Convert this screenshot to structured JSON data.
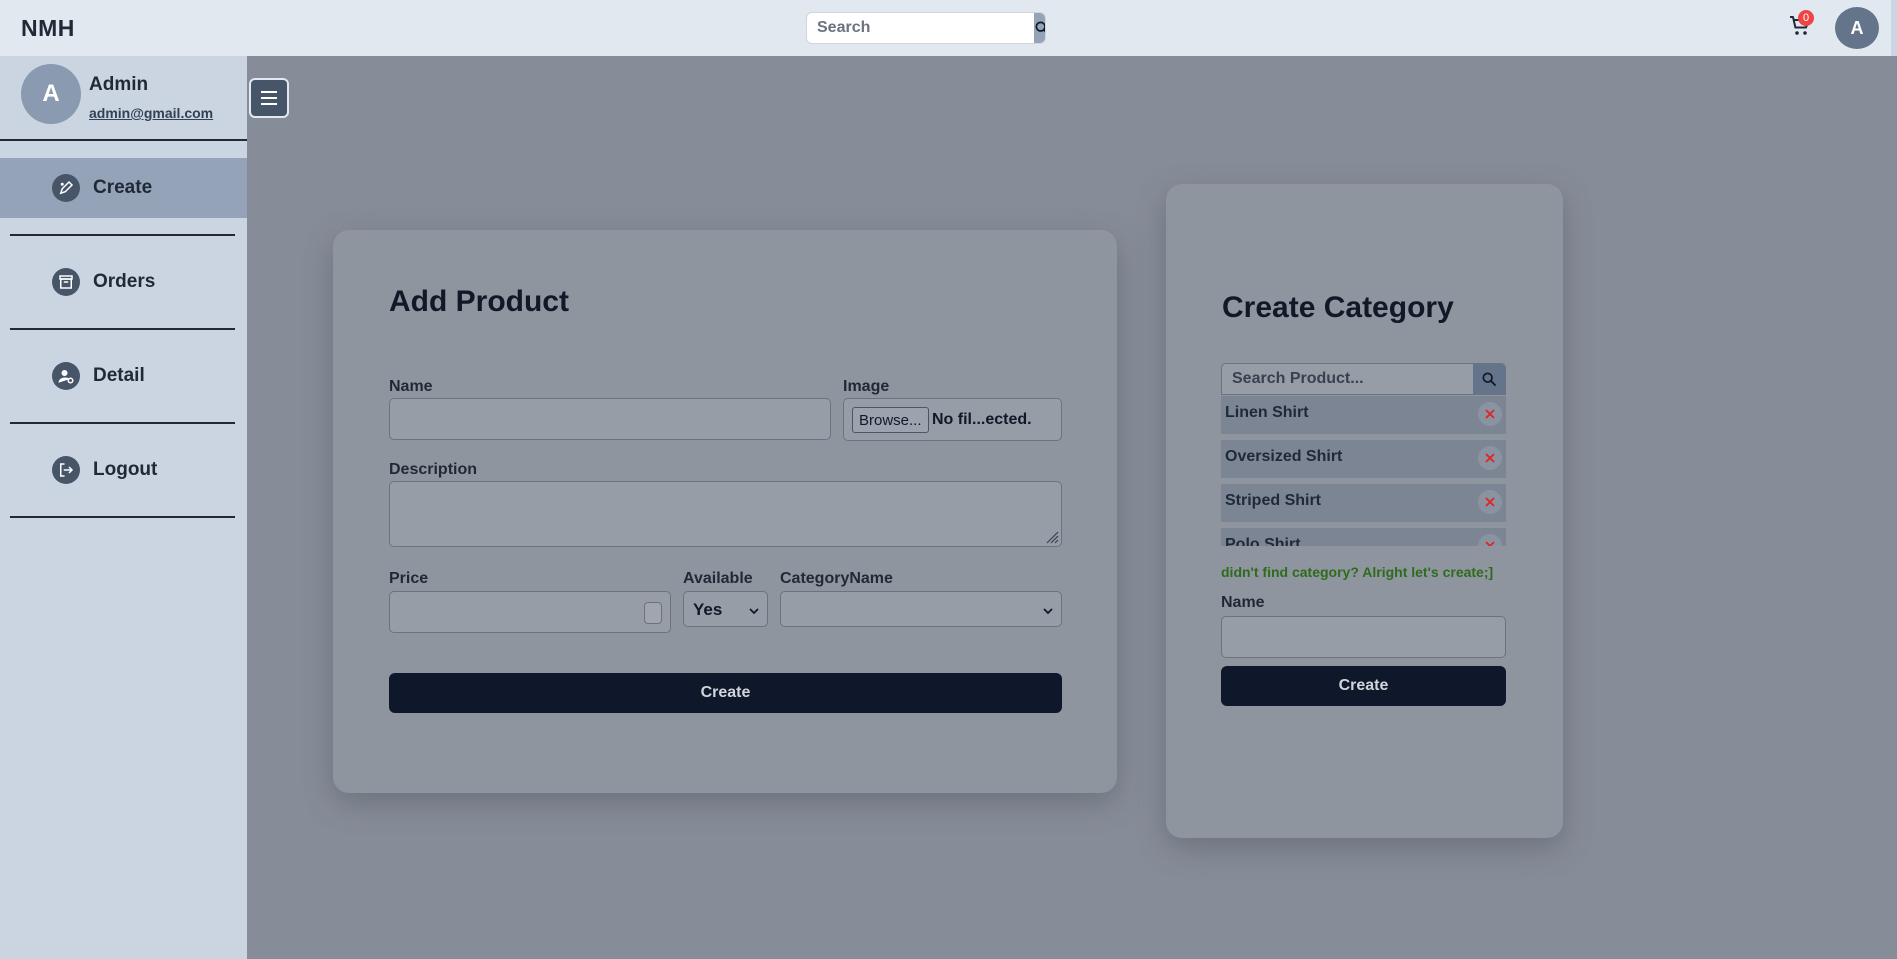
{
  "topbar": {
    "brand": "NMH",
    "search_placeholder": "Search",
    "cart_count": "0",
    "avatar_initial": "A"
  },
  "sidebar": {
    "profile": {
      "initial": "A",
      "name": "Admin",
      "email": "admin@gmail.com"
    },
    "items": [
      {
        "label": "Create",
        "icon": "create-icon",
        "active": true
      },
      {
        "label": "Orders",
        "icon": "orders-icon",
        "active": false
      },
      {
        "label": "Detail",
        "icon": "user-settings-icon",
        "active": false
      },
      {
        "label": "Logout",
        "icon": "logout-icon",
        "active": false
      }
    ]
  },
  "add_product": {
    "title": "Add Product",
    "name_label": "Name",
    "name_value": "",
    "image_label": "Image",
    "browse_label": "Browse...",
    "file_status": "No fil...ected.",
    "description_label": "Description",
    "description_value": "",
    "price_label": "Price",
    "price_value": "",
    "available_label": "Available",
    "available_value": "Yes",
    "category_label": "CategoryName",
    "category_value": "",
    "submit_label": "Create"
  },
  "create_category": {
    "title": "Create Category",
    "search_placeholder": "Search Product...",
    "categories": [
      "Linen Shirt",
      "Oversized Shirt",
      "Striped Shirt",
      "Polo Shirt"
    ],
    "hint": "didn't find category? Alright let's create;]",
    "name_label": "Name",
    "name_value": "",
    "submit_label": "Create"
  },
  "colors": {
    "accent_dark": "#0f172a",
    "sidebar_active": "#94a3b8",
    "badge": "#ef4444",
    "hint_green": "#2f6b1d",
    "delete_red": "#dc2626"
  }
}
